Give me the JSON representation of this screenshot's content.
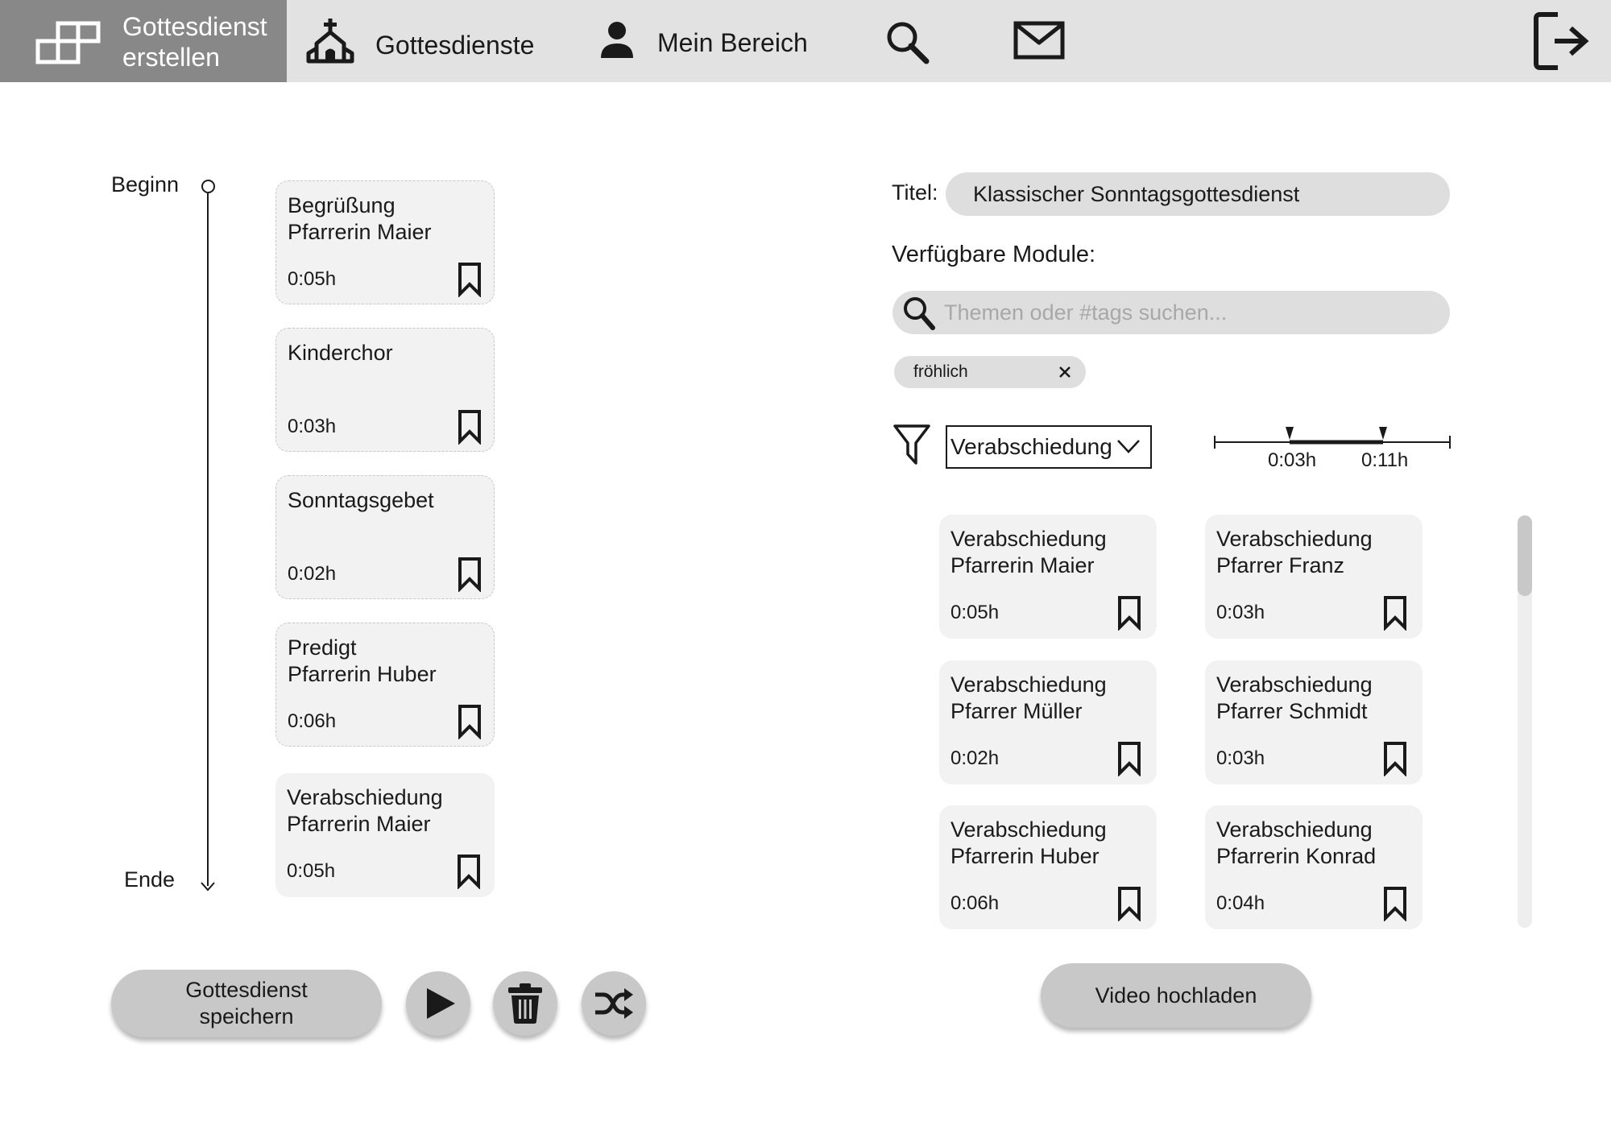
{
  "nav": {
    "active_item": {
      "label": "Gottesdienst erstellen",
      "line1": "Gottesdienst",
      "line2": "erstellen",
      "icon": "blocks-icon"
    },
    "items": [
      {
        "label": "Gottesdienste",
        "icon": "church-icon"
      },
      {
        "label": "Mein Bereich",
        "icon": "person-icon"
      }
    ],
    "search_icon": "search-icon",
    "mail_icon": "mail-icon",
    "logout_icon": "logout-icon"
  },
  "timeline": {
    "start_label": "Beginn",
    "end_label": "Ende",
    "modules": [
      {
        "line1": "Begrüßung",
        "line2": "Pfarrerin Maier",
        "duration": "0:05h",
        "style": "dashed"
      },
      {
        "line1": "Kinderchor",
        "line2": "",
        "duration": "0:03h",
        "style": "dashed"
      },
      {
        "line1": "Sonntagsgebet",
        "line2": "",
        "duration": "0:02h",
        "style": "dashed"
      },
      {
        "line1": "Predigt",
        "line2": "Pfarrerin Huber",
        "duration": "0:06h",
        "style": "dashed"
      },
      {
        "line1": "Verabschiedung",
        "line2": "Pfarrerin Maier",
        "duration": "0:05h",
        "style": "solid"
      }
    ]
  },
  "actions": {
    "save_line1": "Gottesdienst",
    "save_line2": "speichern",
    "play_icon": "play-icon",
    "delete_icon": "trash-icon",
    "shuffle_icon": "shuffle-icon"
  },
  "right_panel": {
    "title_label": "Titel:",
    "title_value": "Klassischer Sonntagsgottesdienst",
    "modules_label": "Verfügbare Module:",
    "search_placeholder": "Themen oder #tags suchen...",
    "tags": [
      {
        "label": "fröhlich"
      }
    ],
    "filter_icon": "filter-icon",
    "category_selected": "Verabschiedung",
    "duration_range": {
      "min_label": "0:03h",
      "max_label": "0:11h"
    },
    "available_modules": [
      {
        "line1": "Verabschiedung",
        "line2": "Pfarrerin Maier",
        "duration": "0:05h"
      },
      {
        "line1": "Verabschiedung",
        "line2": "Pfarrer Franz",
        "duration": "0:03h"
      },
      {
        "line1": "Verabschiedung",
        "line2": "Pfarrer Müller",
        "duration": "0:02h"
      },
      {
        "line1": "Verabschiedung",
        "line2": "Pfarrer Schmidt",
        "duration": "0:03h"
      },
      {
        "line1": "Verabschiedung",
        "line2": "Pfarrerin Huber",
        "duration": "0:06h"
      },
      {
        "line1": "Verabschiedung",
        "line2": "Pfarrerin Konrad",
        "duration": "0:04h"
      }
    ],
    "upload_label": "Video hochladen"
  }
}
